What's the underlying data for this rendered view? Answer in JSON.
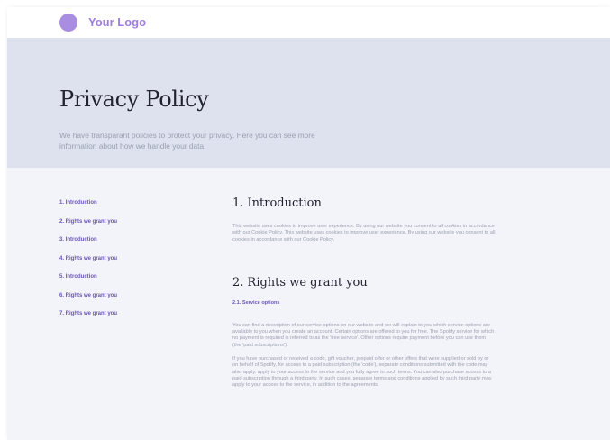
{
  "header": {
    "logo_text": "Your Logo",
    "logo_color": "#a98de0"
  },
  "hero": {
    "title": "Privacy Policy",
    "subtitle": "We have transparant policies to protect your privacy. Here you can see more information about how we handle your data."
  },
  "toc": {
    "items": [
      {
        "label": "1. Introduction"
      },
      {
        "label": "2. Rights we grant you"
      },
      {
        "label": "3. Introduction"
      },
      {
        "label": "4. Rights we grant you"
      },
      {
        "label": "5. Introduction"
      },
      {
        "label": "6. Rights we grant you"
      },
      {
        "label": "7. Rights we grant you"
      }
    ]
  },
  "sections": {
    "intro": {
      "title": "1. Introduction",
      "text": "This website uses cookies to improve user experience. By using our website you consent to all cookies in accordance with our Cookie Policy. This website uses cookies to improve user experience. By using our website you consent to all cookies in accordance with our Cookie Policy."
    },
    "rights": {
      "title": "2. Rights we grant you",
      "subtitle": "2.1. Service options",
      "para1": "You can find a description of our service options on our website and we will explain to you which service options are available to you when you create an account. Certain options are offered to you for free. The Spotify service for which no payment is required is referred to as the 'free service'. Other options require payment before you can use them (the 'paid subscriptions').",
      "para2": "If you have purchased or received a code, gift voucher, prepaid offer or other offers that were supplied or sold by or on behalf of Spotify, for access to a paid subscription (the 'code'), separate conditions submitted with the code may also apply. apply to your access to the service and you fully agree to such terms. You can also purchase access to a paid subscription through a third party. In such cases, separate terms and conditions applied by such third party may apply to your access to the service, in addition to the agreements."
    }
  },
  "colors": {
    "accent": "#6c54b8",
    "hero_bg": "#dee2ee",
    "page_bg": "#f3f4fa"
  }
}
